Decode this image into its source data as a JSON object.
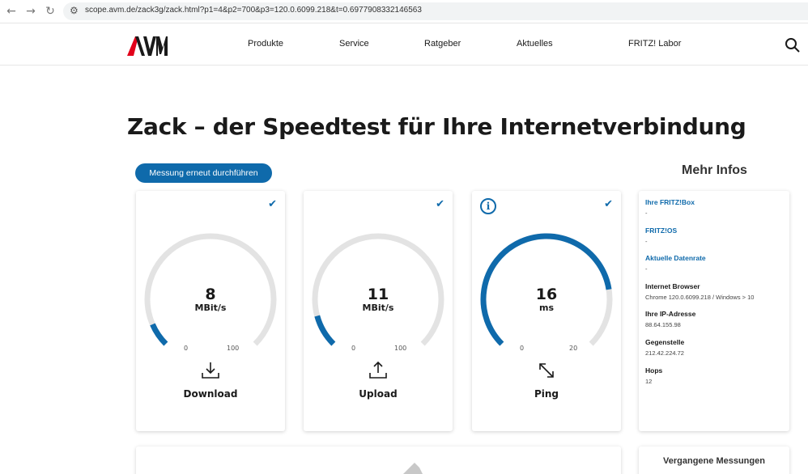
{
  "browser": {
    "url": "scope.avm.de/zack3g/zack.html?p1=4&p2=700&p3=120.0.6099.218&t=0.6977908332146563"
  },
  "header": {
    "logo_text": "AVM",
    "menu": [
      "Produkte",
      "Service",
      "Ratgeber",
      "Aktuelles",
      "FRITZ! Labor"
    ]
  },
  "page_title": "Zack – der Speedtest für Ihre Internetverbindung",
  "rerun_button": "Messung erneut durchführen",
  "more_title": "Mehr Infos",
  "colors": {
    "accent": "#0f6aab",
    "track": "#e3e3e3",
    "logo_red": "#e2001a"
  },
  "cards": [
    {
      "label": "Download",
      "value": "8",
      "unit": "MBit/s",
      "min": "0",
      "max": "100",
      "fraction": 0.08,
      "icon": "download-icon"
    },
    {
      "label": "Upload",
      "value": "11",
      "unit": "MBit/s",
      "min": "0",
      "max": "100",
      "fraction": 0.11,
      "icon": "upload-icon"
    },
    {
      "label": "Ping",
      "value": "16",
      "unit": "ms",
      "min": "0",
      "max": "20",
      "fraction": 0.8,
      "icon": "resize-arrows-icon"
    }
  ],
  "info": [
    {
      "label": "Ihre FRITZ!Box",
      "value": "-"
    },
    {
      "label": "FRITZ!OS",
      "value": "-"
    },
    {
      "label": "Aktuelle Datenrate",
      "value": "-"
    },
    {
      "label": "Internet Browser",
      "value": "Chrome 120.0.6099.218 / Windows > 10"
    },
    {
      "label": "Ihre IP-Adresse",
      "value": "88.64.155.98"
    },
    {
      "label": "Gegenstelle",
      "value": "212.42.224.72"
    },
    {
      "label": "Hops",
      "value": "12"
    }
  ],
  "past_title": "Vergangene Messungen"
}
